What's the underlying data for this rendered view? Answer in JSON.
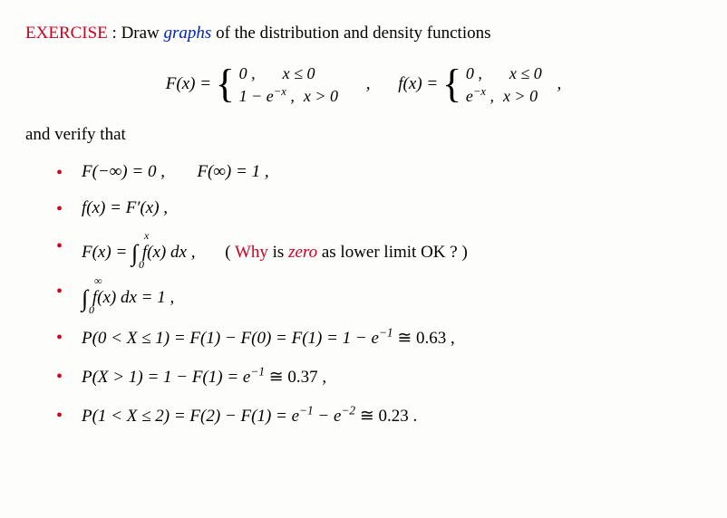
{
  "header": {
    "label": "EXERCISE",
    "colon": " : ",
    "prefix": "Draw ",
    "keyword": "graphs",
    "suffix": " of the distribution and density functions"
  },
  "eq": {
    "F_lhs": "F(x) = ",
    "F_row1_a": "0 ,",
    "F_row1_b": "x ≤ 0",
    "F_row2_a": "1 − e",
    "F_row2_exp": "−x",
    "F_row2_a2": " ,",
    "F_row2_b": "x > 0",
    "comma": ",",
    "f_lhs": "f(x) = ",
    "f_row1_a": "0 ,",
    "f_row1_b": "x ≤ 0",
    "f_row2_a": "e",
    "f_row2_exp": "−x",
    "f_row2_a2": " ,",
    "f_row2_b": "x > 0",
    "comma2": ","
  },
  "verify": "and verify that",
  "b1": {
    "a": "F(−∞)  =  0 ,",
    "b": "F(∞)  =  1 ,"
  },
  "b2": {
    "a": "f(x)  =  F′(x) ,"
  },
  "b3": {
    "a": "F(x)  =  ",
    "int_lo": "0",
    "int_hi": "x",
    "body": " f(x) dx ,",
    "note_open": "( ",
    "note_why": "Why",
    "note_mid": " is  ",
    "note_zero": "zero",
    "note_end": "  as lower limit OK ? )"
  },
  "b4": {
    "int_lo": "0",
    "int_hi": "∞",
    "body": " f(x) dx  =  1 ,"
  },
  "b5": {
    "a": "P(0 < X ≤ 1)  =  F(1) − F(0)  =  F(1)  =  1 − e",
    "exp": "−1",
    "b": "  ≅  0.63 ,"
  },
  "b6": {
    "a": "P(X > 1)  =  1 − F(1)  =  e",
    "exp": "−1",
    "b": "  ≅  0.37 ,"
  },
  "b7": {
    "a": "P(1 < X ≤ 2)  =  F(2) − F(1)  =  e",
    "exp1": "−1",
    "mid": " − e",
    "exp2": "−2",
    "b": "  ≅  0.23 ."
  }
}
